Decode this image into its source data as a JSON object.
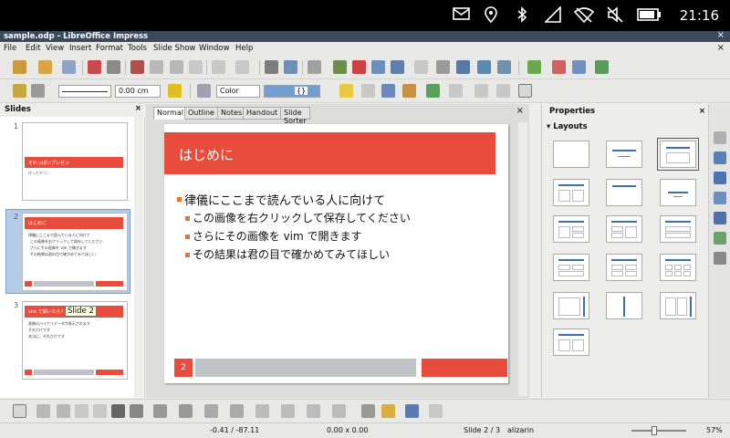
{
  "android": {
    "time": "21:16"
  },
  "window": {
    "title": "sample.odp - LibreOffice Impress",
    "close": "×"
  },
  "menu": {
    "items": [
      "File",
      "Edit",
      "View",
      "Insert",
      "Format",
      "Tools",
      "Slide Show",
      "Window",
      "Help"
    ],
    "close": "×"
  },
  "format_bar": {
    "line_width": "0.00 cm",
    "area_style": "Color",
    "area_color": "{}"
  },
  "slides_panel": {
    "title": "Slides",
    "close": "×",
    "tooltip": "Slide 2",
    "thumbs": [
      {
        "num": "1",
        "title": "それっぽいプレゼン",
        "sub": "作ったやつ..."
      },
      {
        "num": "2",
        "title": "はじめに",
        "lines": [
          "律儀にここまで読んでいる人に向けて",
          "この画像を右クリックして保存してください",
          "さらにその画像を vim で開きます",
          "その結果は君の目で確かめてみてほしい"
        ],
        "footer_num": "2"
      },
      {
        "num": "3",
        "title": "vim で開いたら？",
        "lines": [
          "画像のバイナリデータが表示されます",
          "それだけです",
          "本当に、それだけです"
        ]
      }
    ]
  },
  "editor": {
    "tabs": [
      "Normal",
      "Outline",
      "Notes",
      "Handout",
      "Slide Sorter"
    ],
    "close": "×",
    "slide": {
      "title": "はじめに",
      "bullet_main": "律儀にここまで読んでいる人に向けて",
      "sub_bullets": [
        "この画像を右クリックして保存してください",
        "さらにその画像を vim で開きます",
        "その結果は君の目で確かめてみてほしい"
      ],
      "slide_number": "2"
    }
  },
  "properties": {
    "title": "Properties",
    "close": "×",
    "section": "Layouts"
  },
  "statusbar": {
    "position": "-0.41 / -87.11",
    "size": "0.00 x 0.00",
    "slide": "Slide 2 / 3",
    "master": "alizarin",
    "zoom": "57%"
  },
  "colors": {
    "accent": "#e84c3d",
    "footer_gray": "#bfc2c6",
    "bullet": "#e8752e"
  }
}
